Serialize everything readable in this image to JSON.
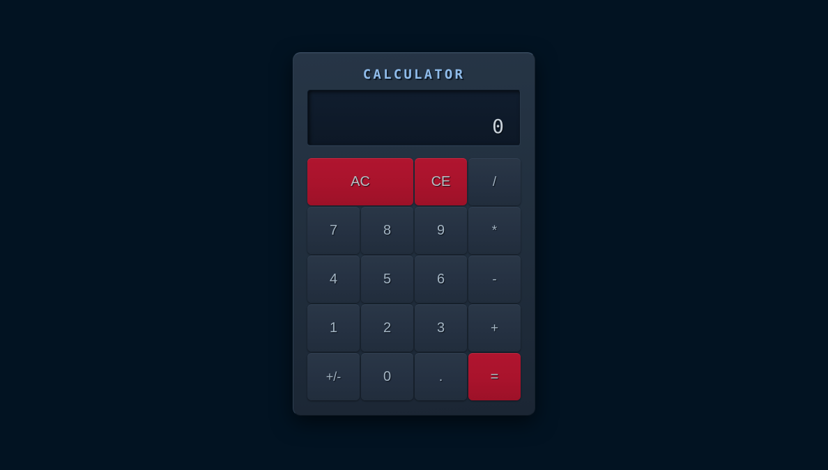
{
  "app": {
    "title": "CALCULATOR",
    "background_color": "#021322",
    "body_color": "#22303f",
    "accent_color": "#a9132c",
    "key_color": "#253142",
    "text_color": "#a3b4c2",
    "title_color": "#8fbbe9"
  },
  "display": {
    "value": "0",
    "placeholder": "0"
  },
  "keypad": {
    "keys": [
      {
        "label": "AC",
        "name": "key-all-clear",
        "style": "accent",
        "span": 2
      },
      {
        "label": "CE",
        "name": "key-clear-entry",
        "style": "accent",
        "span": 1
      },
      {
        "label": "/",
        "name": "key-divide",
        "style": "operator",
        "span": 1
      },
      {
        "label": "7",
        "name": "key-7",
        "style": "digit",
        "span": 1
      },
      {
        "label": "8",
        "name": "key-8",
        "style": "digit",
        "span": 1
      },
      {
        "label": "9",
        "name": "key-9",
        "style": "digit",
        "span": 1
      },
      {
        "label": "*",
        "name": "key-multiply",
        "style": "operator",
        "span": 1
      },
      {
        "label": "4",
        "name": "key-4",
        "style": "digit",
        "span": 1
      },
      {
        "label": "5",
        "name": "key-5",
        "style": "digit",
        "span": 1
      },
      {
        "label": "6",
        "name": "key-6",
        "style": "digit",
        "span": 1
      },
      {
        "label": "-",
        "name": "key-subtract",
        "style": "operator",
        "span": 1
      },
      {
        "label": "1",
        "name": "key-1",
        "style": "digit",
        "span": 1
      },
      {
        "label": "2",
        "name": "key-2",
        "style": "digit",
        "span": 1
      },
      {
        "label": "3",
        "name": "key-3",
        "style": "digit",
        "span": 1
      },
      {
        "label": "+",
        "name": "key-add",
        "style": "operator",
        "span": 1
      },
      {
        "label": "+/-",
        "name": "key-sign-toggle",
        "style": "function",
        "span": 1
      },
      {
        "label": "0",
        "name": "key-0",
        "style": "digit",
        "span": 1
      },
      {
        "label": ".",
        "name": "key-decimal",
        "style": "digit",
        "span": 1
      },
      {
        "label": "=",
        "name": "key-equals",
        "style": "accent",
        "span": 1
      }
    ]
  }
}
